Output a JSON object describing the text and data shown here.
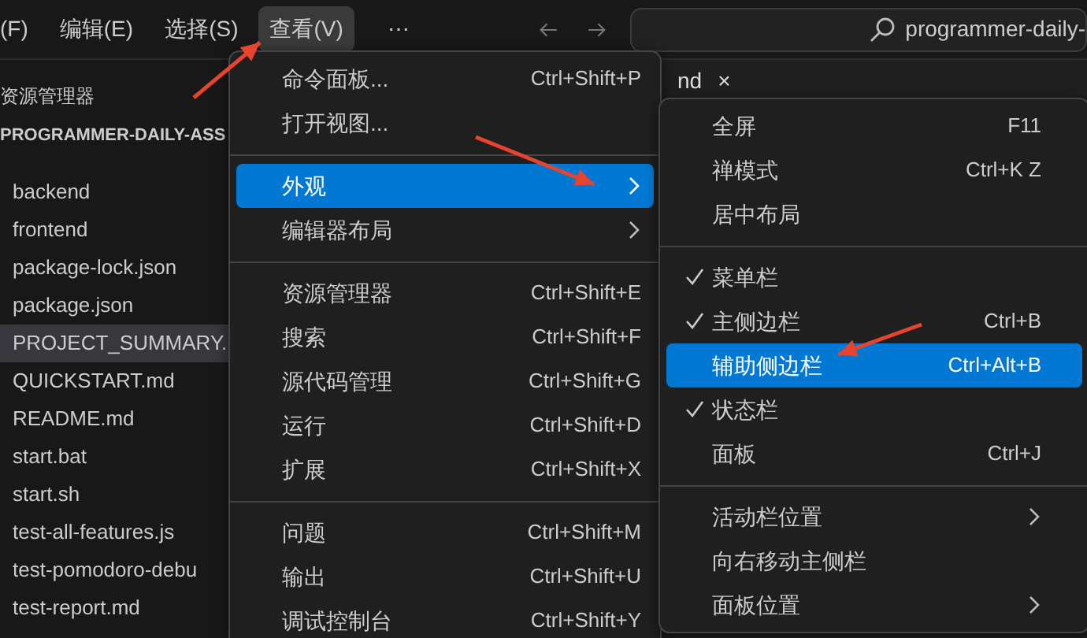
{
  "menubar": {
    "items": [
      {
        "label": "(F)",
        "selected": false
      },
      {
        "label": "编辑(E)",
        "selected": false
      },
      {
        "label": "选择(S)",
        "selected": false
      },
      {
        "label": "查看(V)",
        "selected": true
      }
    ],
    "more": "⋯",
    "search": {
      "value": "programmer-daily-"
    }
  },
  "sidebar": {
    "title": "资源管理器",
    "folder": "PROGRAMMER-DAILY-ASS",
    "items": [
      {
        "label": "backend",
        "selected": false
      },
      {
        "label": "frontend",
        "selected": false
      },
      {
        "label": "package-lock.json",
        "selected": false
      },
      {
        "label": "package.json",
        "selected": false
      },
      {
        "label": "PROJECT_SUMMARY.",
        "selected": true
      },
      {
        "label": "QUICKSTART.md",
        "selected": false
      },
      {
        "label": "README.md",
        "selected": false
      },
      {
        "label": "start.bat",
        "selected": false
      },
      {
        "label": "start.sh",
        "selected": false
      },
      {
        "label": "test-all-features.js",
        "selected": false
      },
      {
        "label": "test-pomodoro-debu",
        "selected": false
      },
      {
        "label": "test-report.md",
        "selected": false
      }
    ]
  },
  "editor_tab": {
    "label": "nd",
    "close": "×"
  },
  "view_menu": {
    "groups": [
      [
        {
          "label": "命令面板...",
          "shortcut": "Ctrl+Shift+P",
          "submenu": false,
          "selected": false
        },
        {
          "label": "打开视图...",
          "submenu": false,
          "selected": false
        }
      ],
      [
        {
          "label": "外观",
          "submenu": true,
          "selected": true
        },
        {
          "label": "编辑器布局",
          "submenu": true,
          "selected": false
        }
      ],
      [
        {
          "label": "资源管理器",
          "shortcut": "Ctrl+Shift+E",
          "submenu": false,
          "selected": false
        },
        {
          "label": "搜索",
          "shortcut": "Ctrl+Shift+F",
          "submenu": false,
          "selected": false
        },
        {
          "label": "源代码管理",
          "shortcut": "Ctrl+Shift+G",
          "submenu": false,
          "selected": false
        },
        {
          "label": "运行",
          "shortcut": "Ctrl+Shift+D",
          "submenu": false,
          "selected": false
        },
        {
          "label": "扩展",
          "shortcut": "Ctrl+Shift+X",
          "submenu": false,
          "selected": false
        }
      ],
      [
        {
          "label": "问题",
          "shortcut": "Ctrl+Shift+M",
          "submenu": false,
          "selected": false
        },
        {
          "label": "输出",
          "shortcut": "Ctrl+Shift+U",
          "submenu": false,
          "selected": false
        },
        {
          "label": "调试控制台",
          "shortcut": "Ctrl+Shift+Y",
          "submenu": false,
          "selected": false
        }
      ]
    ]
  },
  "appearance_menu": {
    "groups": [
      [
        {
          "label": "全屏",
          "shortcut": "F11",
          "checked": false,
          "submenu": false,
          "selected": false
        },
        {
          "label": "禅模式",
          "shortcut": "Ctrl+K Z",
          "checked": false,
          "submenu": false,
          "selected": false
        },
        {
          "label": "居中布局",
          "checked": false,
          "submenu": false,
          "selected": false
        }
      ],
      [
        {
          "label": "菜单栏",
          "checked": true,
          "submenu": false,
          "selected": false
        },
        {
          "label": "主侧边栏",
          "shortcut": "Ctrl+B",
          "checked": true,
          "submenu": false,
          "selected": false
        },
        {
          "label": "辅助侧边栏",
          "shortcut": "Ctrl+Alt+B",
          "checked": false,
          "submenu": false,
          "selected": true
        },
        {
          "label": "状态栏",
          "checked": true,
          "submenu": false,
          "selected": false
        },
        {
          "label": "面板",
          "shortcut": "Ctrl+J",
          "checked": false,
          "submenu": false,
          "selected": false
        }
      ],
      [
        {
          "label": "活动栏位置",
          "checked": false,
          "submenu": true,
          "selected": false
        },
        {
          "label": "向右移动主侧栏",
          "checked": false,
          "submenu": false,
          "selected": false
        },
        {
          "label": "面板位置",
          "checked": false,
          "submenu": true,
          "selected": false
        }
      ]
    ]
  }
}
